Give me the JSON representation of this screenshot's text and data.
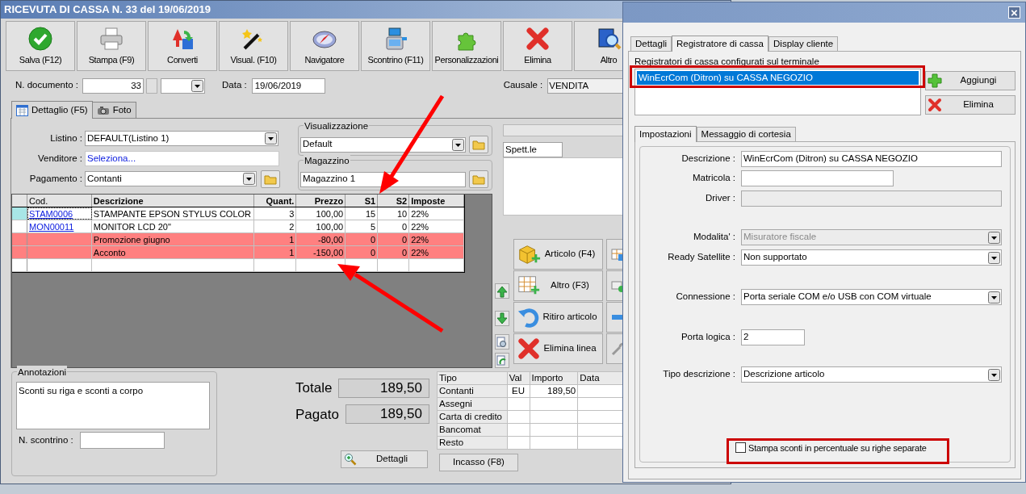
{
  "window": {
    "title": "RICEVUTA DI CASSA N. 33 del 19/06/2019"
  },
  "toolbar": [
    "Salva (F12)",
    "Stampa (F9)",
    "Converti",
    "Visual. (F10)",
    "Navigatore",
    "Scontrino (F11)",
    "Personalizzazioni",
    "Elimina",
    "Altro"
  ],
  "header": {
    "doc_number_label": "N. documento :",
    "doc_number": "33",
    "date_label": "Data :",
    "date": "19/06/2019",
    "causale_label": "Causale :",
    "causale": "VENDITA"
  },
  "tabs": [
    {
      "label": "Dettaglio (F5)",
      "selected": true
    },
    {
      "label": "Foto",
      "selected": false
    }
  ],
  "form": [
    {
      "label": "Listino :",
      "value": "DEFAULT(Listino 1)",
      "kind": "dropdown"
    },
    {
      "label": "Venditore :",
      "value": "Seleziona...",
      "kind": "link"
    },
    {
      "label": "Pagamento :",
      "value": "Contanti",
      "kind": "dropdown_folder"
    }
  ],
  "groups": [
    {
      "title": "Visualizzazione",
      "value": "Default",
      "kind": "dropdown"
    },
    {
      "title": "Magazzino",
      "value": "Magazzino 1",
      "kind": "text"
    }
  ],
  "recipient": {
    "value": "Spett.le"
  },
  "grid": {
    "columns": [
      "Cod.",
      "Descrizione",
      "Quant.",
      "Prezzo",
      "S1",
      "S2",
      "Imposte"
    ],
    "rows": [
      {
        "code": "STAM0006",
        "description": "STAMPANTE EPSON STYLUS COLOR",
        "quantity": "3",
        "price": "100,00",
        "s1": "15",
        "s2": "10",
        "tax": "22%",
        "selected": true,
        "highlighted": false
      },
      {
        "code": "MON00011",
        "description": "MONITOR LCD 20\"",
        "quantity": "2",
        "price": "100,00",
        "s1": "5",
        "s2": "0",
        "tax": "22%",
        "selected": false,
        "highlighted": false
      },
      {
        "description": "Promozione giugno",
        "quantity": "1",
        "price": "-80,00",
        "s1": "0",
        "s2": "0",
        "tax": "22%",
        "selected": false,
        "highlighted": true
      },
      {
        "description": "Acconto",
        "quantity": "1",
        "price": "-150,00",
        "s1": "0",
        "s2": "0",
        "tax": "22%",
        "selected": false,
        "highlighted": true
      }
    ]
  },
  "side_buttons": [
    "Articolo (F4)",
    "Altro (F3)",
    "Ritiro articolo",
    "Elimina linea"
  ],
  "annotations": {
    "title": "Annotazioni",
    "text": "Sconti su riga e sconti a corpo"
  },
  "receipt_number": {
    "label": "N. scontrino :"
  },
  "totals": [
    {
      "label": "Totale",
      "value": "189,50"
    },
    {
      "label": "Pagato",
      "value": "189,50"
    }
  ],
  "details_button": "Dettagli",
  "payments": {
    "columns": [
      "Tipo",
      "Val",
      "Importo",
      "Data"
    ],
    "rows": [
      [
        "Contanti",
        "EU",
        "189,50"
      ],
      [
        "Assegni"
      ],
      [
        "Carta di credito"
      ],
      [
        "Bancomat"
      ],
      [
        "Resto"
      ]
    ]
  },
  "incasso_button": "Incasso (F8)",
  "dialog": {
    "close": "×",
    "tabs": [
      {
        "label": "Dettagli",
        "selected": false
      },
      {
        "label": "Registratore di cassa",
        "selected": true
      },
      {
        "label": "Display cliente",
        "selected": false
      }
    ],
    "list_label": "Registratori di cassa configurati sul terminale",
    "registers": [
      {
        "label": "WinEcrCom (Ditron) su CASSA NEGOZIO",
        "selected": true
      }
    ],
    "buttons": [
      "Aggiungi",
      "Elimina"
    ],
    "inner_tabs": [
      {
        "label": "Impostazioni",
        "selected": true
      },
      {
        "label": "Messaggio di cortesia",
        "selected": false
      }
    ],
    "fields": [
      {
        "label": "Descrizione :",
        "value": "WinEcrCom (Ditron) su CASSA NEGOZIO",
        "kind": "text",
        "disabled": false
      },
      {
        "label": "Matricola :",
        "kind": "short",
        "disabled": false
      },
      {
        "label": "Driver :",
        "kind": "text",
        "disabled": true
      },
      {
        "label": "Modalita' :",
        "value": "Misuratore fiscale",
        "kind": "dropdown",
        "disabled": true
      },
      {
        "label": "Ready Satellite :",
        "value": "Non supportato",
        "kind": "dropdown",
        "disabled": false
      },
      {
        "label": "Connessione :",
        "value": "Porta seriale COM e/o USB con COM virtuale",
        "kind": "dropdown",
        "disabled": false
      },
      {
        "label": "Porta logica :",
        "value": "2",
        "kind": "tiny",
        "disabled": false
      },
      {
        "label": "Tipo descrizione :",
        "value": "Descrizione articolo",
        "kind": "dropdown",
        "disabled": false
      }
    ],
    "checkbox": {
      "label": "Stampa sconti in percentuale su righe separate",
      "checked": false
    }
  }
}
